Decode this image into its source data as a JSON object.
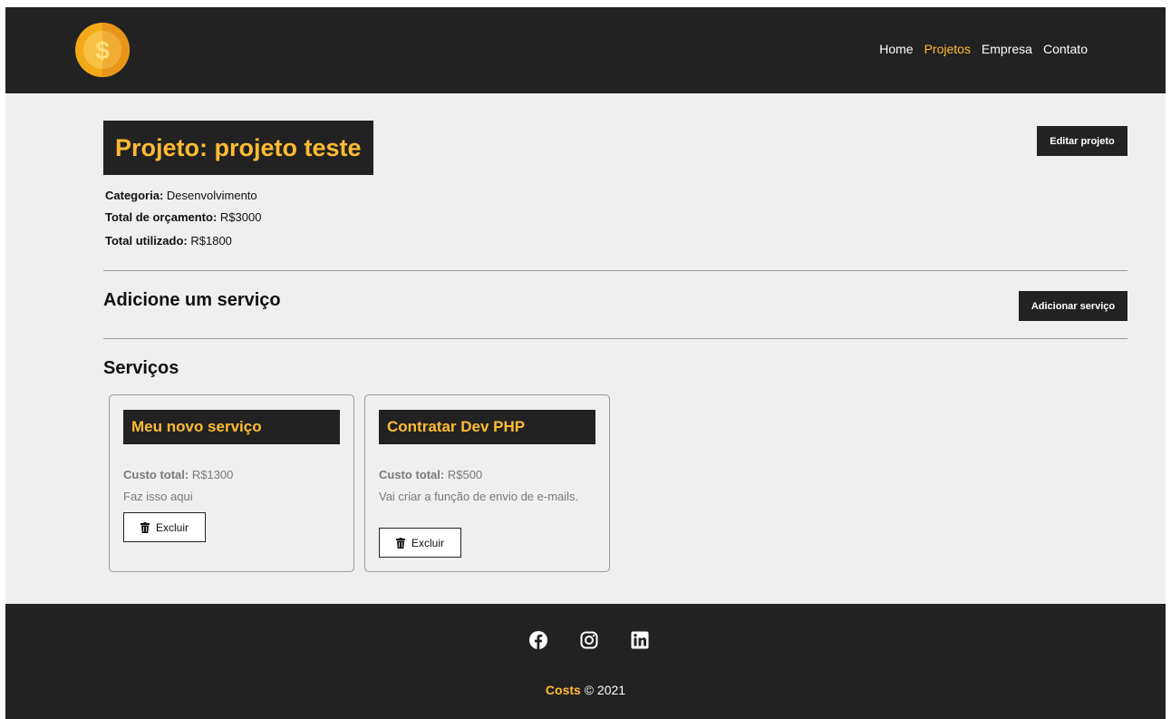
{
  "nav": {
    "links": [
      {
        "label": "Home"
      },
      {
        "label": "Projetos"
      },
      {
        "label": "Empresa"
      },
      {
        "label": "Contato"
      }
    ]
  },
  "project": {
    "title": "Projeto: projeto teste",
    "edit_label": "Editar projeto",
    "category_label": "Categoria:",
    "category": "Desenvolvimento",
    "budget_label": "Total de orçamento:",
    "budget": "R$3000",
    "used_label": "Total utilizado:",
    "used": "R$1800"
  },
  "add_service": {
    "title": "Adicione um serviço",
    "button_label": "Adicionar serviço"
  },
  "services": {
    "title": "Serviços",
    "items": [
      {
        "name": "Meu novo serviço",
        "cost_label": "Custo total:",
        "cost": "R$1300",
        "description": "Faz isso aqui",
        "delete_label": "Excluir"
      },
      {
        "name": "Contratar Dev PHP",
        "cost_label": "Custo total:",
        "cost": "R$500",
        "description": "Vai criar a função de envio de e-mails.",
        "delete_label": "Excluir"
      }
    ]
  },
  "footer": {
    "brand": "Costs",
    "copyright": "© 2021",
    "icons": [
      "facebook-icon",
      "instagram-icon",
      "linkedin-icon"
    ]
  },
  "colors": {
    "dark": "#222222",
    "accent": "#ffbb33",
    "background": "#efefef"
  }
}
